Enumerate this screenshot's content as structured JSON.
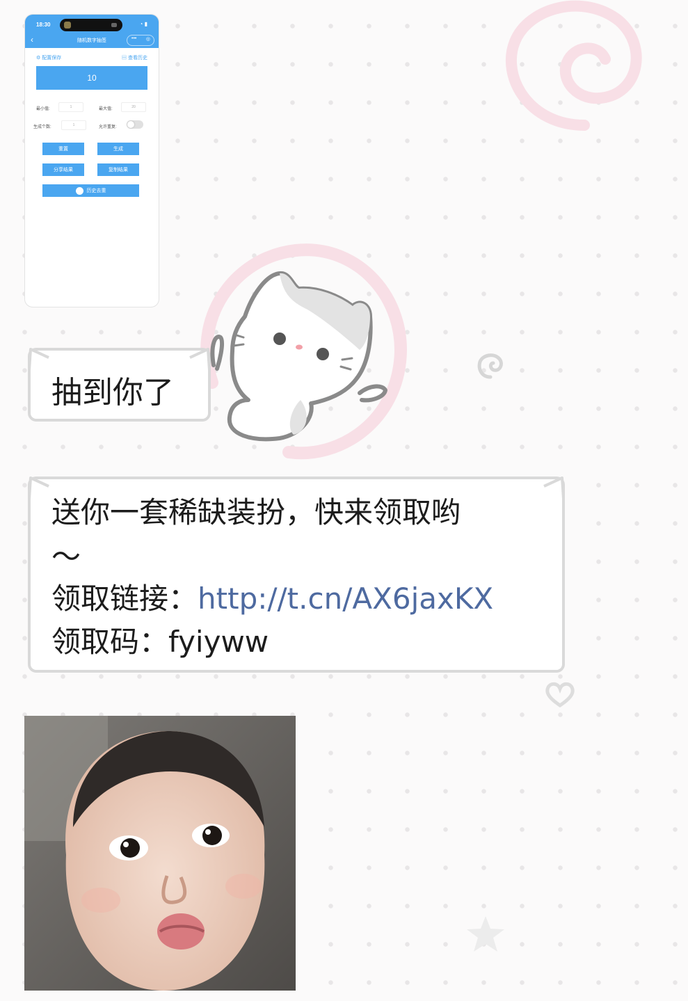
{
  "phone": {
    "time": "18:30",
    "nav_title": "随机数字抽签",
    "config_save": "配置保存",
    "view_history": "查看历史",
    "result": "10",
    "min_label": "最小值:",
    "min_value": "1",
    "max_label": "最大值:",
    "max_value": "20",
    "count_label": "生成个数:",
    "count_value": "1",
    "repeat_label": "允许重复:",
    "repeat_enabled": false,
    "btn_reset": "重置",
    "btn_generate": "生成",
    "btn_share": "分享结果",
    "btn_copy": "复制结果",
    "btn_history_dedupe": "历史去重"
  },
  "messages": {
    "m1": "抽到你了",
    "m2_line1": "送你一套稀缺装扮，快来领取哟",
    "m2_line2": "～",
    "m2_link_label": "领取链接：",
    "m2_link_url": "http://t.cn/AX6jaxKX",
    "m2_code_label": "领取码：",
    "m2_code": "fyiyww"
  },
  "colors": {
    "accent": "#4aa6f0",
    "link": "#4e6aa0",
    "bubble_border": "#d9d9d9",
    "swirl_pink": "#f8dfe6"
  },
  "icons": [
    "cat-sticker-icon",
    "swirl-icon",
    "heart-icon",
    "star-icon",
    "back-arrow-icon",
    "gear-icon",
    "history-doc-icon"
  ]
}
